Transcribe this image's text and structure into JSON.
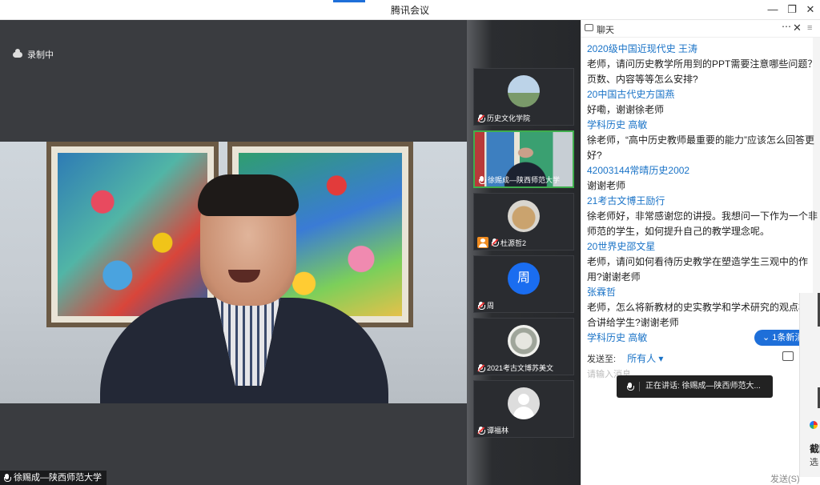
{
  "window": {
    "title": "腾讯会议"
  },
  "stage": {
    "recording_label": "录制中",
    "speaker_name": "徐赐成—陕西师范大学"
  },
  "participants": [
    {
      "name": "历史文化学院",
      "avatar": "landscape-avatar"
    },
    {
      "name": "徐赐成—陕西师范大学",
      "avatar": "video"
    },
    {
      "name": "杜源哲2",
      "avatar": "cat-avatar"
    },
    {
      "name": "周",
      "avatar": "initial-avatar",
      "initial": "周"
    },
    {
      "name": "2021考古文博苏美文",
      "avatar": "photo-avatar"
    },
    {
      "name": "谭福林",
      "avatar": "default-user-avatar"
    }
  ],
  "chat": {
    "title": "聊天",
    "messages": [
      {
        "sender": "2020级中国近现代史 王涛",
        "text": "老师，请问历史教学所用到的PPT需要注意哪些问题？页数、内容等等怎么安排?"
      },
      {
        "sender": "20中国古代史方国燕",
        "text": "好嘞，谢谢徐老师"
      },
      {
        "sender": "学科历史 高敏",
        "text": "徐老师，“高中历史教师最重要的能力”应该怎么回答更好?"
      },
      {
        "sender": "42003144常晴历史2002",
        "text": "谢谢老师"
      },
      {
        "sender": "21考古文博王励行",
        "text": "徐老师好，非常感谢您的讲授。我想问一下作为一个非师范的学生，如何提升自己的教学理念呢。"
      },
      {
        "sender": "20世界史邵文星",
        "text": "老师，请问如何看待历史教学在塑造学生三观中的作用?谢谢老师"
      },
      {
        "sender": "张霖哲",
        "text": "老师，怎么将新教材的史实教学和学术研究的观点相结合讲给学生?谢谢老师"
      },
      {
        "sender": "学科历史 高敏",
        "text": ""
      }
    ],
    "new_message_badge": "1条新消息",
    "send_to_label": "发送至:",
    "send_to_value": "所有人",
    "input_placeholder": "请输入消息...",
    "send_button": "发送(S)"
  },
  "toast": {
    "text": "正在讲话: 徐赐成—陕西师范大..."
  },
  "edge_panel": {
    "title": "截图",
    "subtitle": "选"
  },
  "colors": {
    "accent": "#1e6fd9",
    "link": "#1a73c7",
    "active_tile": "#3fae4d"
  }
}
